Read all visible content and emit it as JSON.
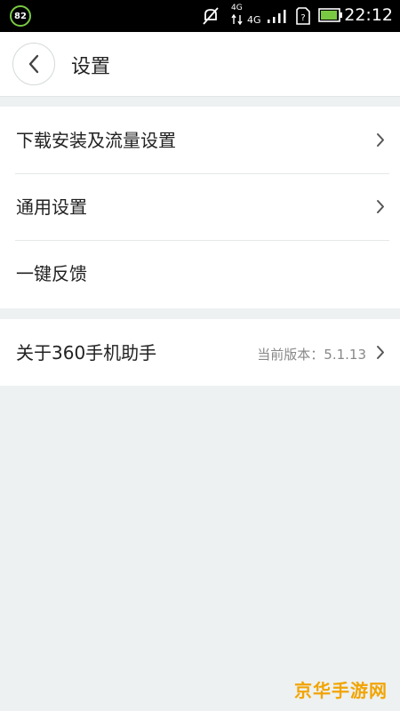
{
  "status_bar": {
    "battery_badge": "82",
    "network_label": "4G",
    "time": "22:12",
    "icons": [
      "muted-icon",
      "network-4g-icon",
      "signal-icon",
      "sim-unknown-icon",
      "battery-icon"
    ]
  },
  "header": {
    "back_icon": "chevron-left-icon",
    "title": "设置"
  },
  "settings": {
    "items": [
      {
        "label": "下载安装及流量设置"
      },
      {
        "label": "通用设置"
      },
      {
        "label": "一键反馈"
      }
    ],
    "about": {
      "label": "关于360手机助手",
      "value": "当前版本：5.1.13"
    }
  },
  "watermark": "京华手游网",
  "colors": {
    "background": "#edf1f1",
    "accent_badge": "#7ac943",
    "watermark": "#f2a400"
  }
}
